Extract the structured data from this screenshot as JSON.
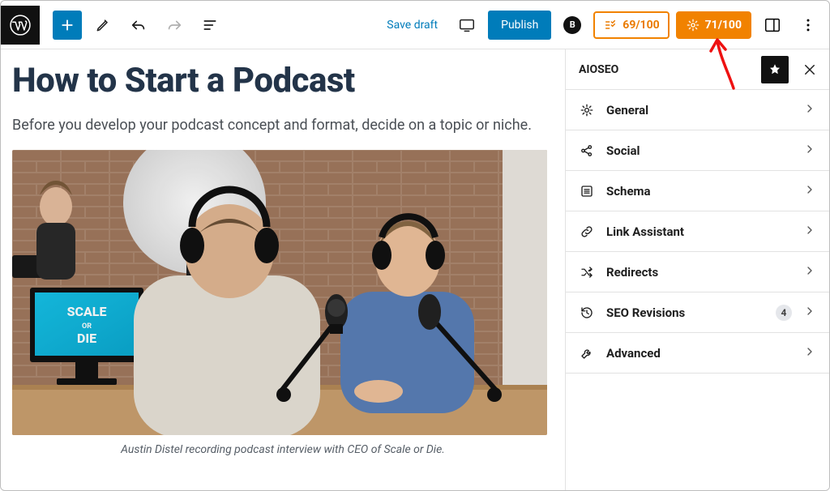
{
  "toolbar": {
    "save_draft": "Save draft",
    "publish": "Publish",
    "score1": "69/100",
    "score2": "71/100"
  },
  "post": {
    "title": "How to Start a Podcast",
    "intro": "Before you develop your podcast concept and format, decide on a topic or niche.",
    "caption": "Austin Distel recording podcast interview with CEO of Scale or Die.",
    "monitor_line1": "SCALE",
    "monitor_line2": "OR",
    "monitor_line3": "DIE"
  },
  "sidebar": {
    "title": "AIOSEO",
    "items": [
      {
        "label": "General",
        "icon": "gear"
      },
      {
        "label": "Social",
        "icon": "share"
      },
      {
        "label": "Schema",
        "icon": "list"
      },
      {
        "label": "Link Assistant",
        "icon": "link"
      },
      {
        "label": "Redirects",
        "icon": "shuffle"
      },
      {
        "label": "SEO Revisions",
        "icon": "history",
        "count": "4"
      },
      {
        "label": "Advanced",
        "icon": "wrench"
      }
    ]
  }
}
